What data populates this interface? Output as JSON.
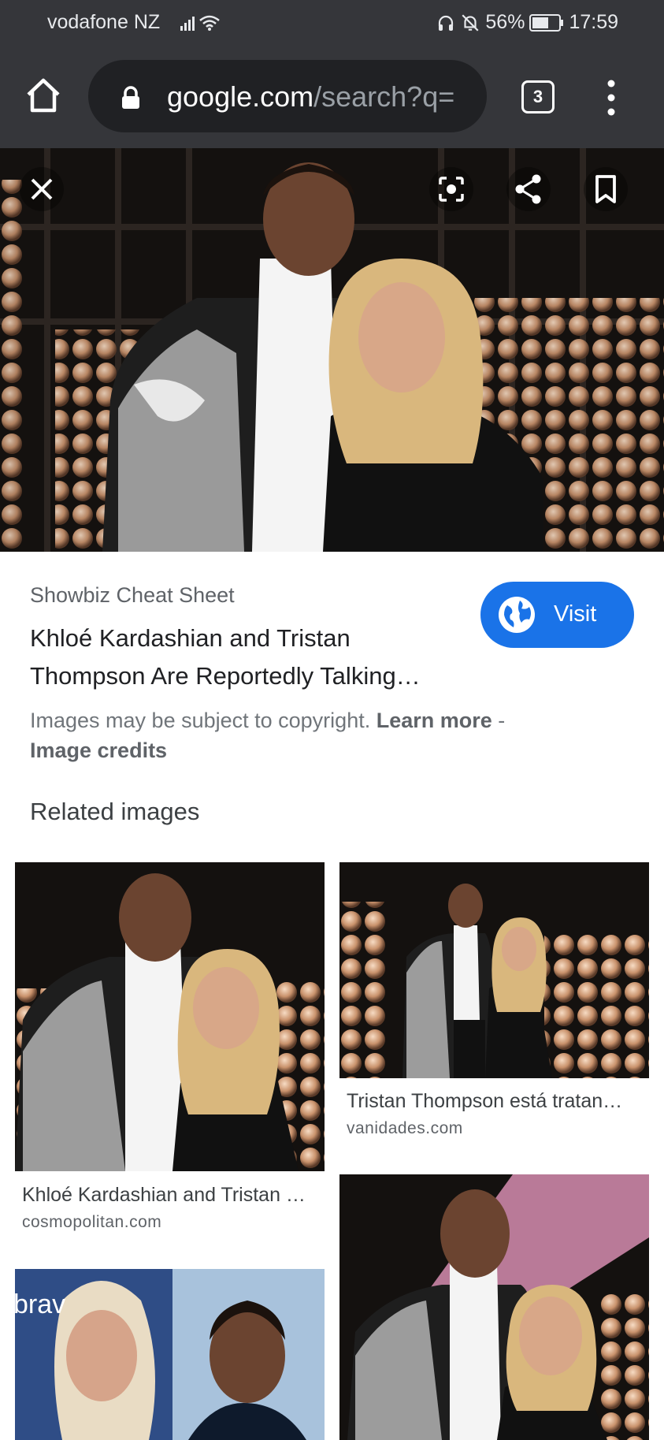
{
  "status_bar": {
    "carrier": "vodafone NZ",
    "battery": "56%",
    "time": "17:59"
  },
  "browser": {
    "url_host": "google.com",
    "url_path": "/search?q=",
    "tab_count": "3"
  },
  "result": {
    "source": "Showbiz Cheat Sheet",
    "title": "Khloé Kardashian and Tristan Thompson Are Reportedly Talking…",
    "visit_label": "Visit",
    "copyright_text": "Images may be subject to copyright.",
    "learn_more": "Learn more",
    "separator": " - ",
    "image_credits": "Image credits"
  },
  "related": {
    "heading": "Related images",
    "items": [
      {
        "caption": "Khloé Kardashian and Tristan …",
        "domain": "cosmopolitan.com"
      },
      {
        "caption": "Tristan Thompson está tratan…",
        "domain": "vanidades.com"
      },
      {
        "sign_text": "brav"
      },
      {
        "caption": "",
        "domain": ""
      }
    ]
  },
  "colors": {
    "chrome_dark": "#35363a",
    "visit_blue": "#1a73e8"
  },
  "icons": [
    "home-icon",
    "lock-icon",
    "tabs-icon",
    "more-vert-icon",
    "close-icon",
    "lens-icon",
    "share-icon",
    "bookmark-icon",
    "globe-icon",
    "signal-icon",
    "wifi-icon",
    "headphones-icon",
    "mute-icon",
    "battery-icon"
  ]
}
